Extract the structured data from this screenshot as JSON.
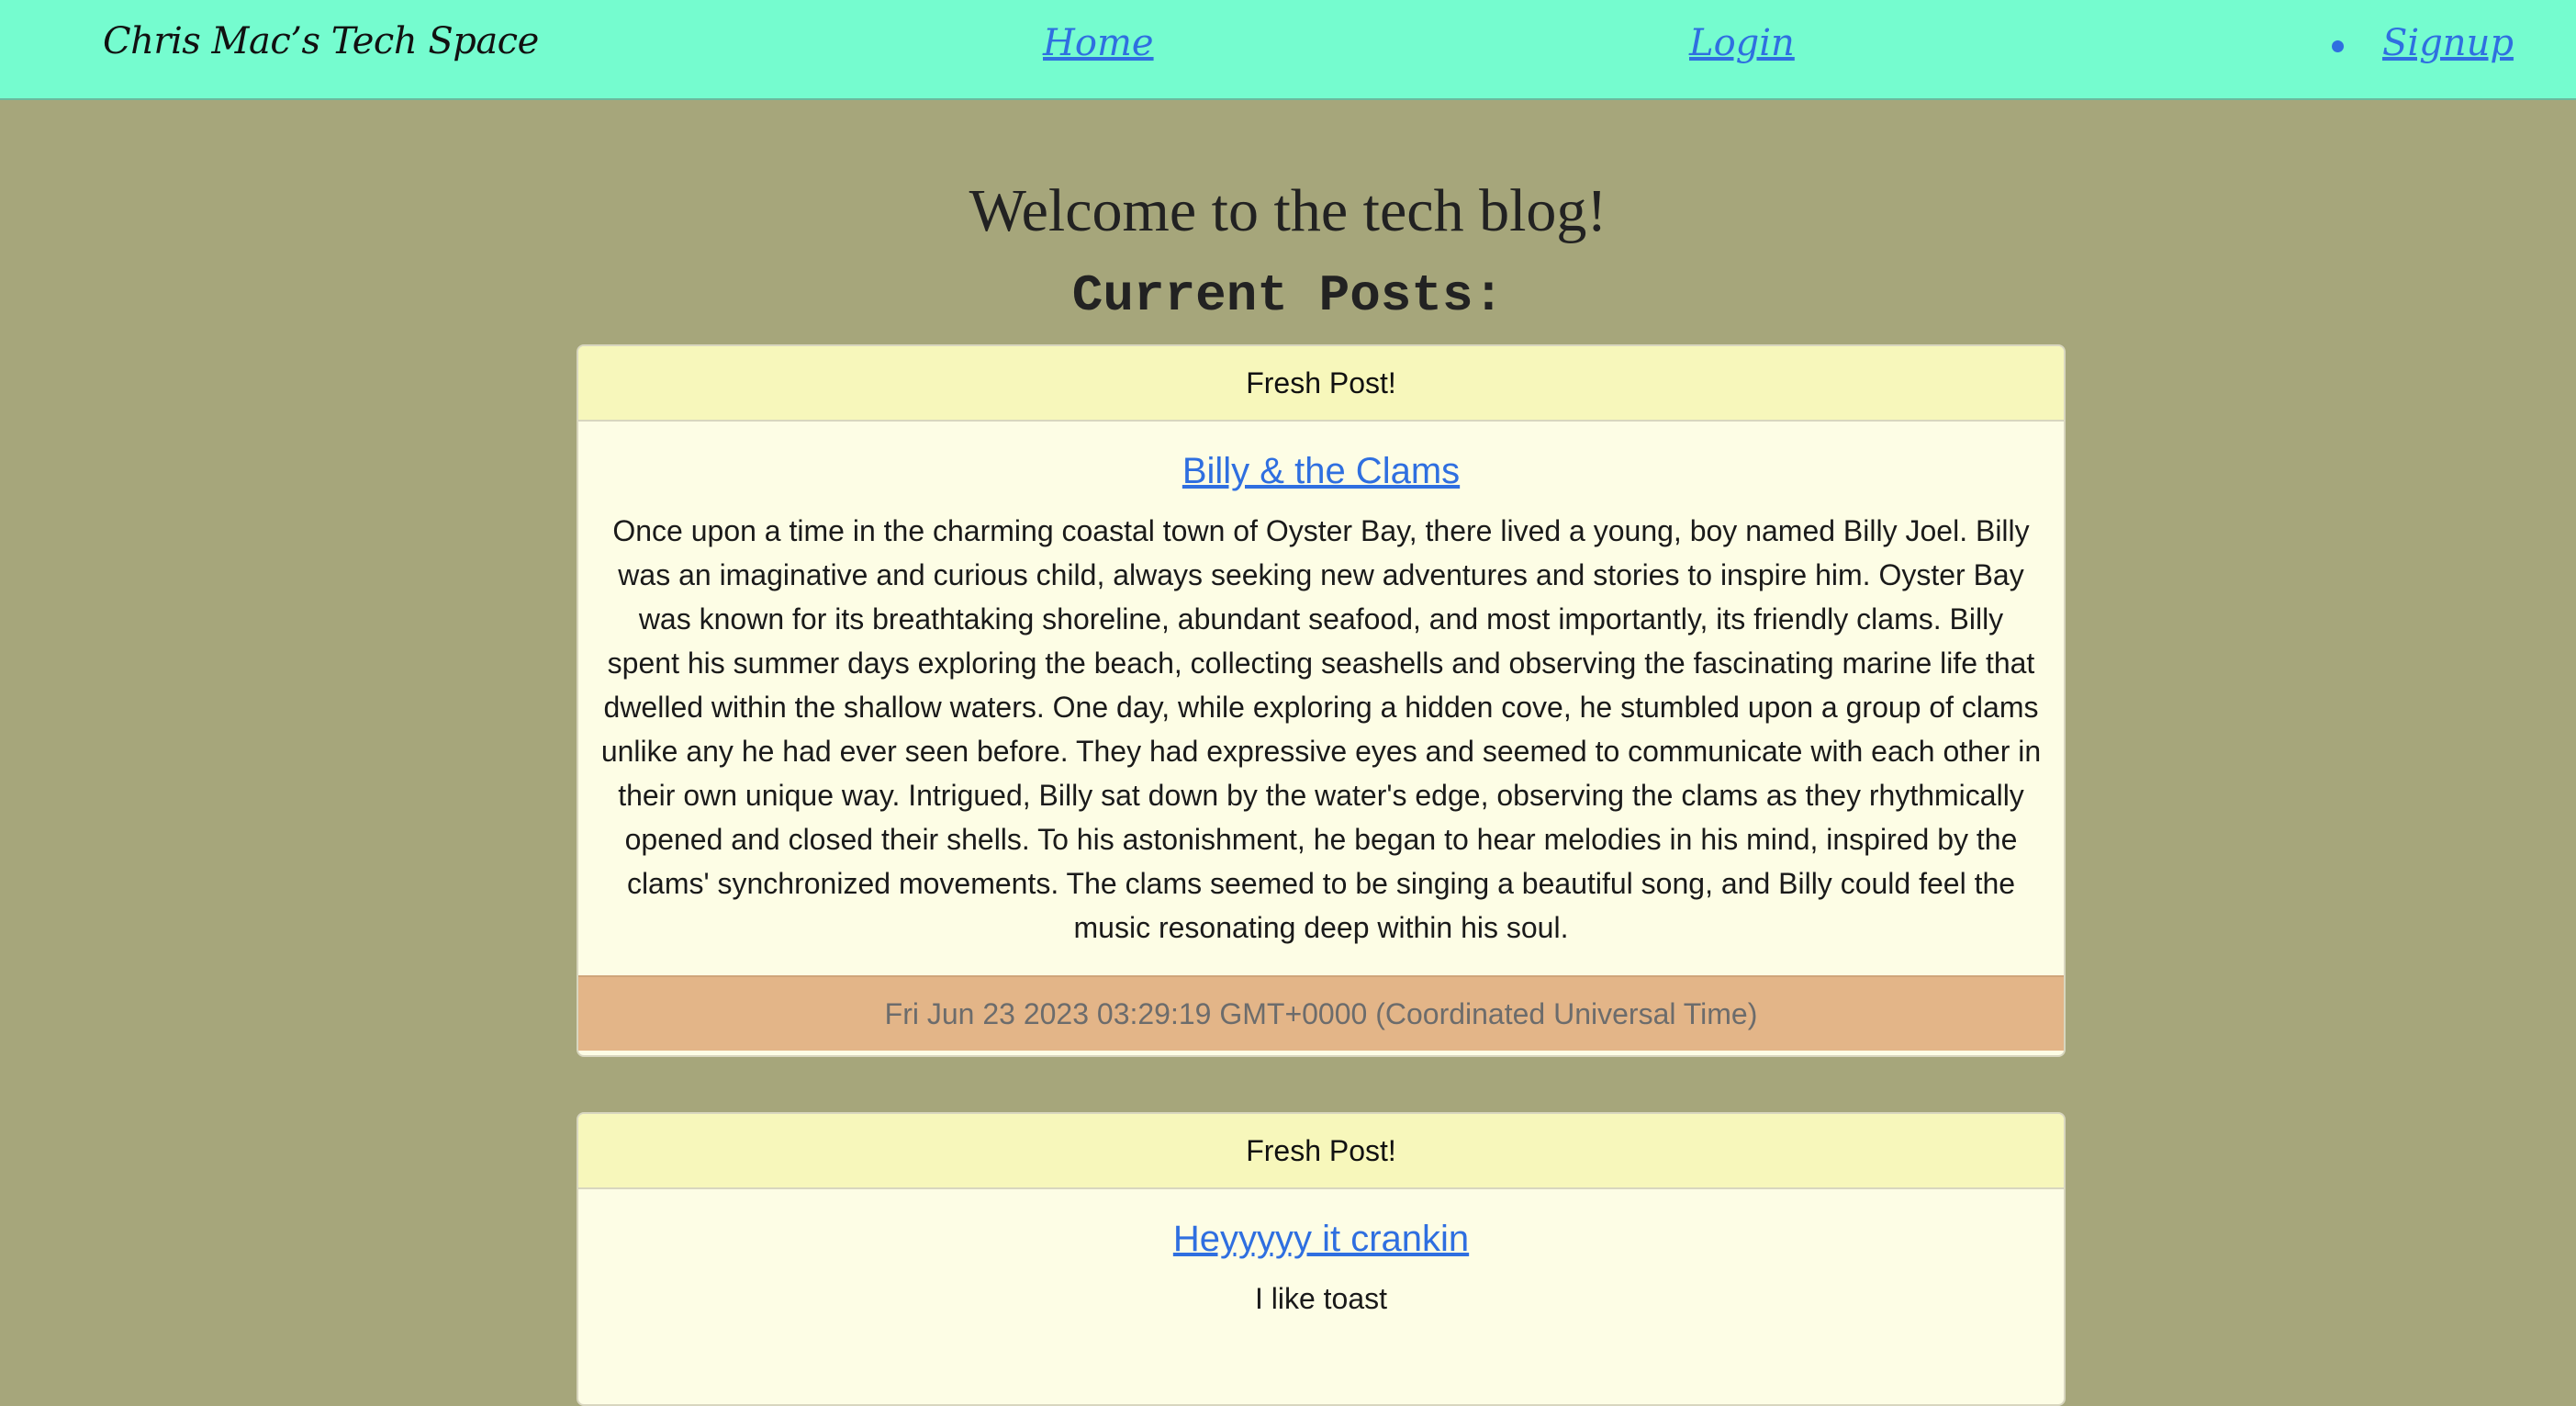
{
  "navbar": {
    "brand": "Chris Mac’s Tech Space",
    "home": "Home",
    "login": "Login",
    "signup": "Signup"
  },
  "main": {
    "welcome": "Welcome to the tech blog!",
    "current_posts": "Current Posts:"
  },
  "posts": [
    {
      "header": "Fresh Post!",
      "title": "Billy & the Clams",
      "body": "Once upon a time in the charming coastal town of Oyster Bay, there lived a young, boy named Billy Joel. Billy was an imaginative and curious child, always seeking new adventures and stories to inspire him. Oyster Bay was known for its breathtaking shoreline, abundant seafood, and most importantly, its friendly clams. Billy spent his summer days exploring the beach, collecting seashells and observing the fascinating marine life that dwelled within the shallow waters. One day, while exploring a hidden cove, he stumbled upon a group of clams unlike any he had ever seen before. They had expressive eyes and seemed to communicate with each other in their own unique way. Intrigued, Billy sat down by the water's edge, observing the clams as they rhythmically opened and closed their shells. To his astonishment, he began to hear melodies in his mind, inspired by the clams' synchronized movements. The clams seemed to be singing a beautiful song, and Billy could feel the music resonating deep within his soul.",
      "footer": "Fri Jun 23 2023 03:29:19 GMT+0000 (Coordinated Universal Time)"
    },
    {
      "header": "Fresh Post!",
      "title": "Heyyyyy it crankin",
      "body": "I like toast"
    }
  ]
}
